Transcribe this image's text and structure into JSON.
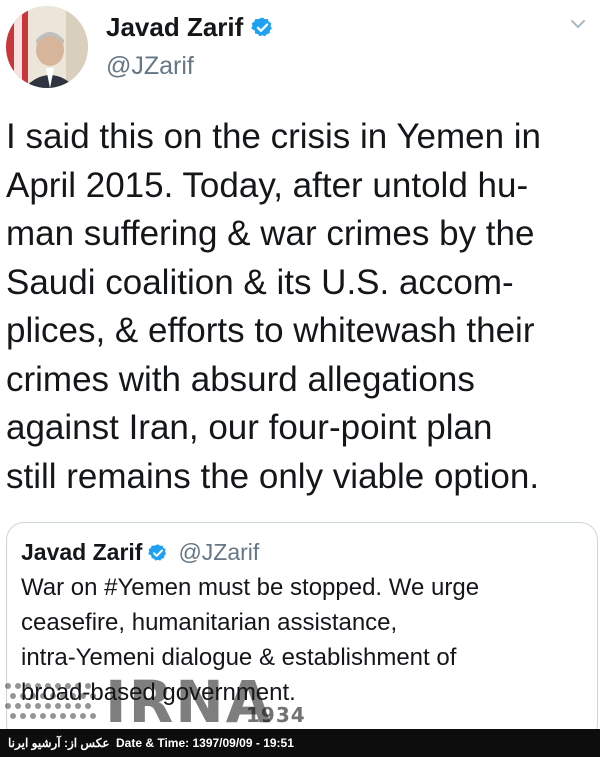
{
  "tweet": {
    "author_name": "Javad Zarif",
    "author_handle": "@JZarif",
    "text_lines": [
      "I said this on the crisis in Yemen in",
      "April 2015. Today, after untold hu-",
      "man suffering & war crimes by the",
      "Saudi coalition & its U.S. accom-",
      "plices, & efforts to whitewash their",
      "crimes with absurd allegations",
      "against Iran, our four-point plan",
      "still remains the only viable option."
    ]
  },
  "quoted_tweet": {
    "author_name": "Javad Zarif",
    "author_handle": "@JZarif",
    "text_lines": [
      "War on #Yemen must be stopped. We urge",
      "ceasefire, humanitarian assistance,",
      "intra-Yemeni dialogue & establishment of",
      "broad-based government."
    ]
  },
  "watermark": {
    "brand": "IRNA",
    "year": "1934"
  },
  "footer": {
    "credit": "عکس از: آرشیو ایرنا",
    "datetime": "Date & Time: 1397/09/09 - 19:51"
  },
  "icons": {
    "verified": "verified-badge-icon",
    "more": "chevron-down-icon"
  },
  "colors": {
    "verified_blue": "#1da1f2",
    "handle_gray": "#657786",
    "footer_bg": "#0d0d0d"
  }
}
